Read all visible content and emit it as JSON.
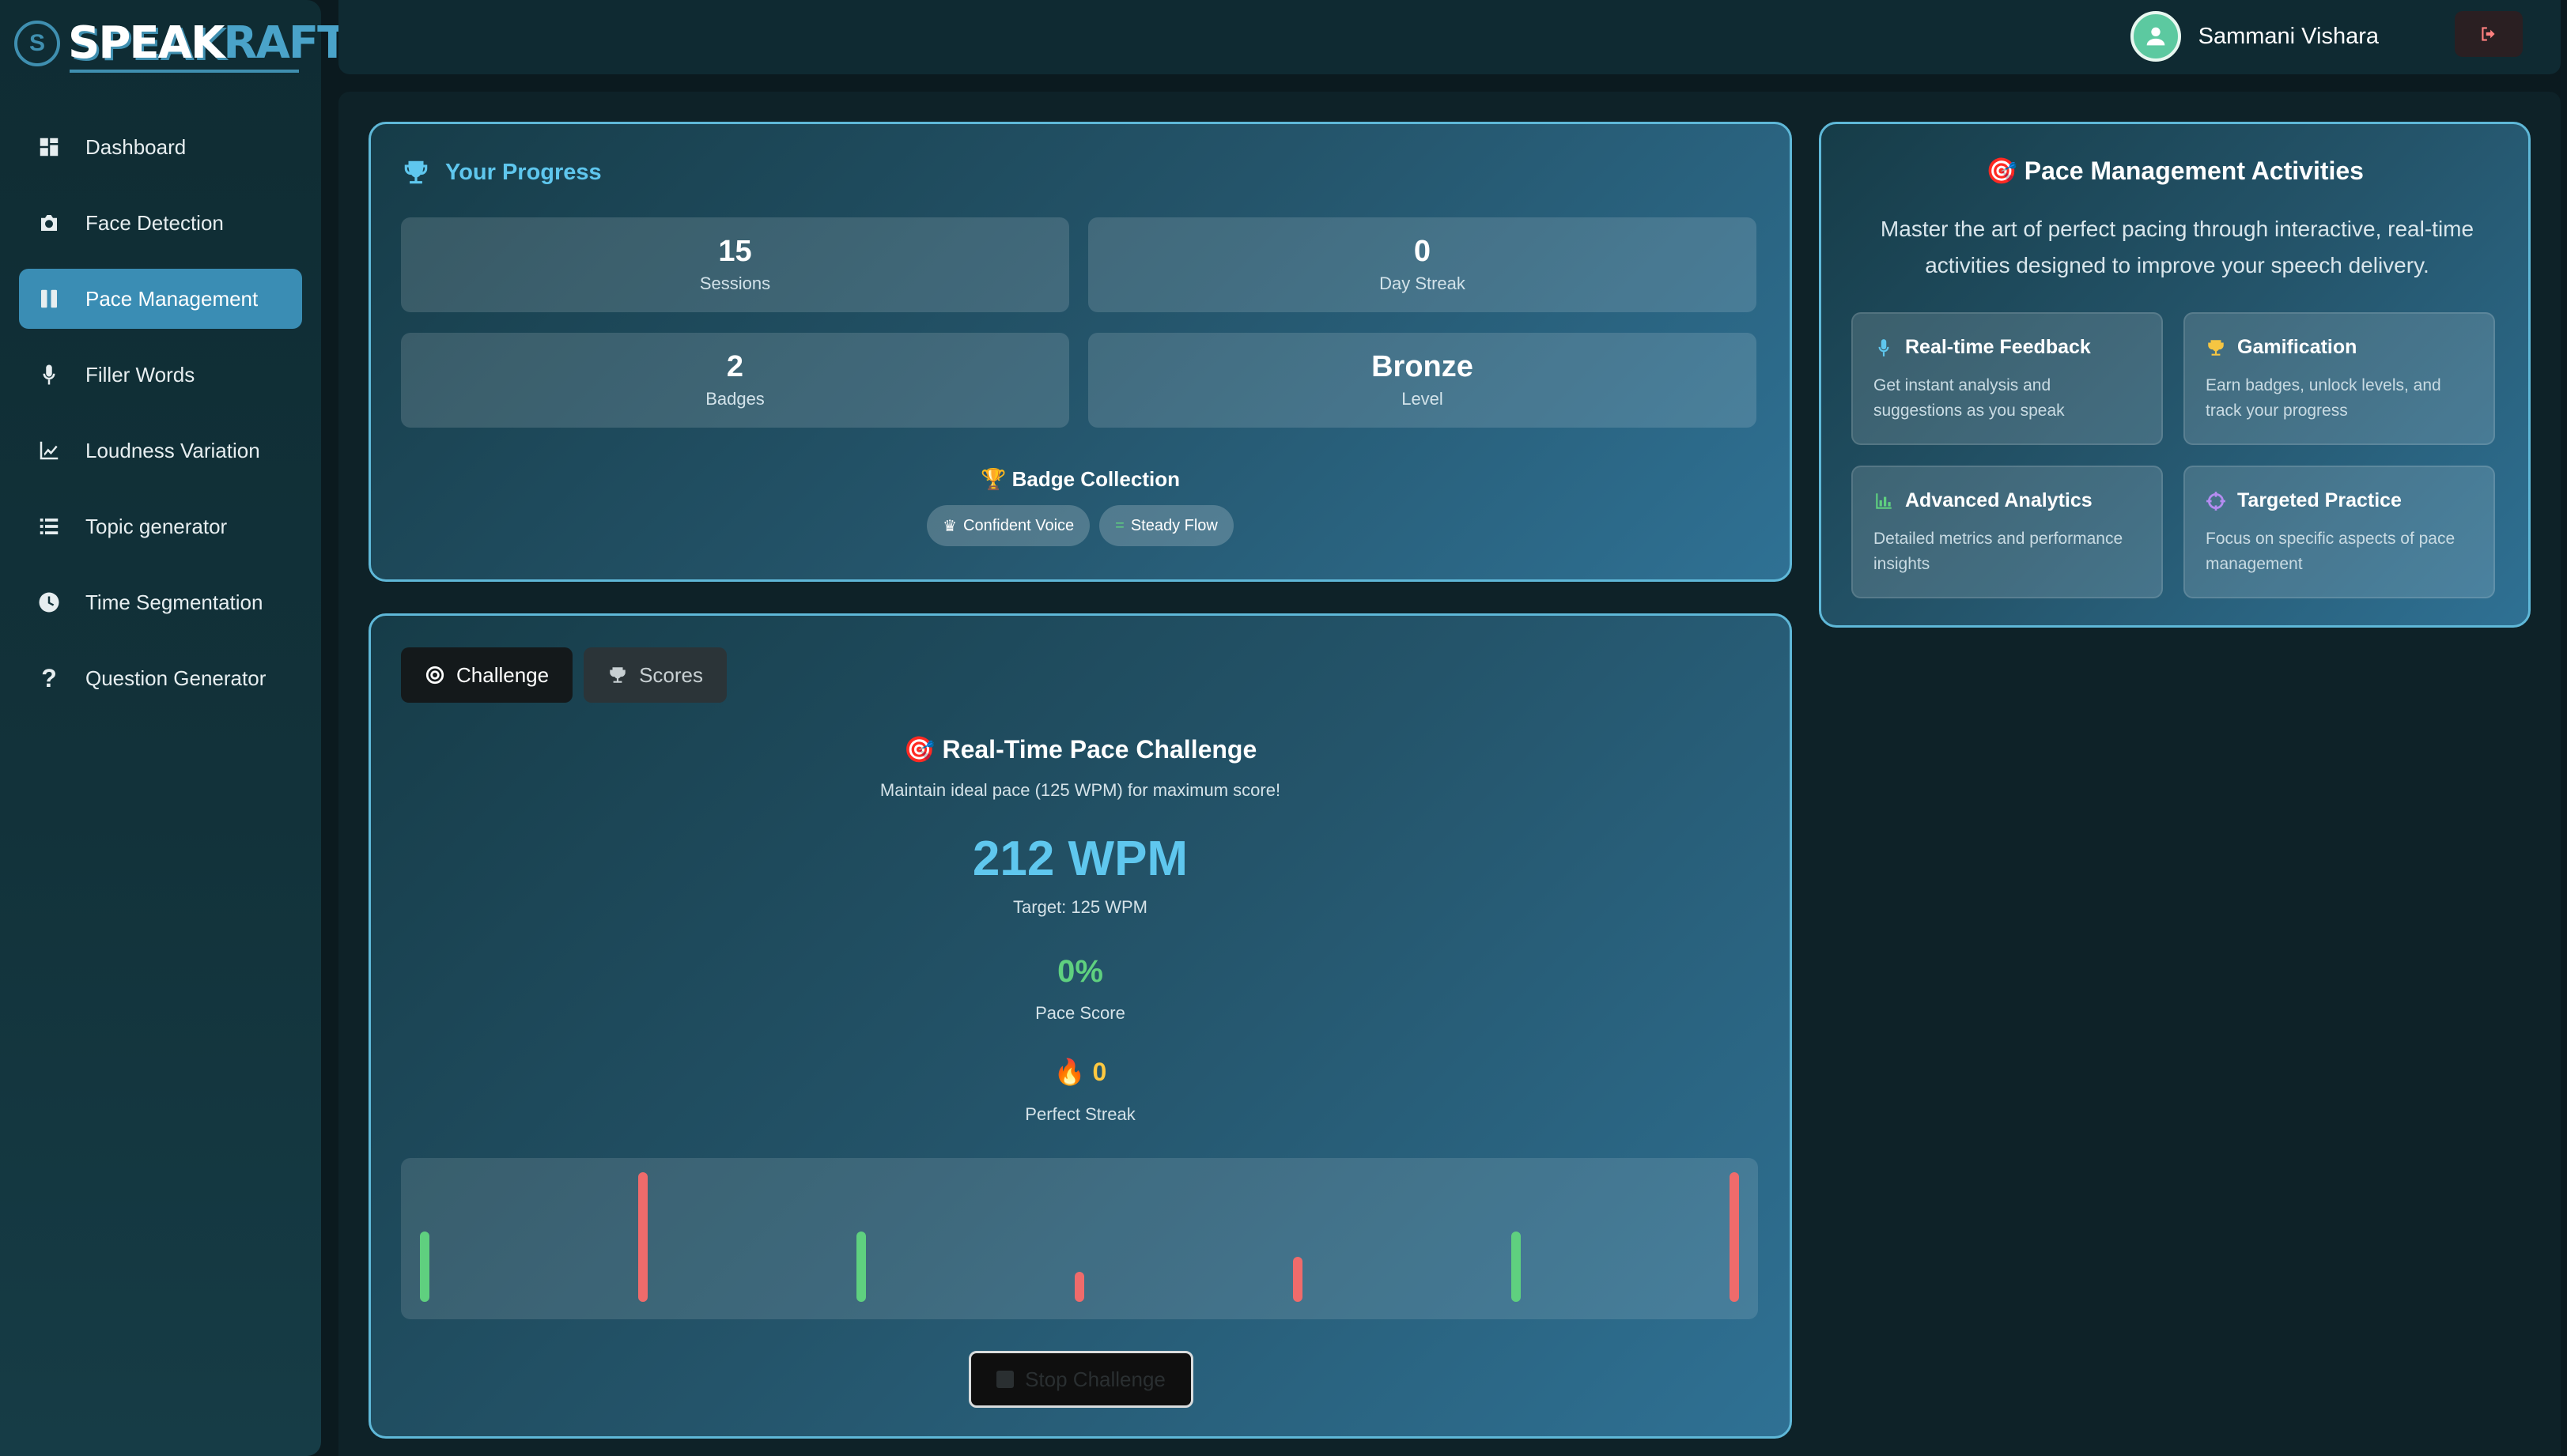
{
  "logo": {
    "speak": "SPEAK",
    "raft": "RAFT"
  },
  "sidebar": {
    "items": [
      {
        "label": "Dashboard",
        "icon": "dashboard-icon"
      },
      {
        "label": "Face Detection",
        "icon": "camera-icon"
      },
      {
        "label": "Pace Management",
        "icon": "pause-bars-icon",
        "active": true
      },
      {
        "label": "Filler Words",
        "icon": "microphone-icon"
      },
      {
        "label": "Loudness Variation",
        "icon": "line-chart-icon"
      },
      {
        "label": "Topic generator",
        "icon": "list-icon"
      },
      {
        "label": "Time Segmentation",
        "icon": "clock-icon"
      },
      {
        "label": "Question Generator",
        "icon": "question-icon"
      }
    ]
  },
  "header": {
    "user_name": "Sammani Vishara",
    "logout_icon": "logout-icon"
  },
  "progress": {
    "title": "Your Progress",
    "stats": [
      {
        "value": "15",
        "label": "Sessions"
      },
      {
        "value": "0",
        "label": "Day Streak"
      },
      {
        "value": "2",
        "label": "Badges"
      },
      {
        "value": "Bronze",
        "label": "Level"
      }
    ],
    "badge_collection_title": "🏆 Badge Collection",
    "badges": [
      {
        "icon": "♛",
        "label": "Confident Voice"
      },
      {
        "icon": "=",
        "label": "Steady Flow"
      }
    ]
  },
  "challenge": {
    "tabs": [
      {
        "label": "Challenge",
        "icon": "target-icon",
        "active": true
      },
      {
        "label": "Scores",
        "icon": "trophy-icon",
        "active": false
      }
    ],
    "title": "🎯 Real-Time Pace Challenge",
    "subtitle": "Maintain ideal pace (125 WPM) for maximum score!",
    "wpm": "212 WPM",
    "target": "Target: 125 WPM",
    "score": "0%",
    "score_label": "Pace Score",
    "streak": "🔥 0",
    "streak_label": "Perfect Streak",
    "stop_label": "Stop Challenge",
    "colors": {
      "good": "#5fd07f",
      "bad": "#ef6b6b"
    },
    "pace_bars": [
      {
        "level": 0.28,
        "status": "good"
      },
      {
        "level": 0.52,
        "status": "bad"
      },
      {
        "level": 0.28,
        "status": "good"
      },
      {
        "level": 0.12,
        "status": "bad"
      },
      {
        "level": 0.18,
        "status": "bad"
      },
      {
        "level": 0.28,
        "status": "good"
      },
      {
        "level": 0.52,
        "status": "bad"
      }
    ]
  },
  "activities": {
    "title": "🎯 Pace Management Activities",
    "description": "Master the art of perfect pacing through interactive, real-time activities designed to improve your speech delivery.",
    "features": [
      {
        "title": "Real-time Feedback",
        "icon": "microphone-icon",
        "icon_color": "#5fc7ee",
        "body": "Get instant analysis and suggestions as you speak"
      },
      {
        "title": "Gamification",
        "icon": "trophy-icon",
        "icon_color": "#f5c542",
        "body": "Earn badges, unlock levels, and track your progress"
      },
      {
        "title": "Advanced Analytics",
        "icon": "bar-chart-icon",
        "icon_color": "#5fd07f",
        "body": "Detailed metrics and performance insights"
      },
      {
        "title": "Targeted Practice",
        "icon": "crosshair-icon",
        "icon_color": "#b48cf0",
        "body": "Focus on specific aspects of pace management"
      }
    ]
  }
}
